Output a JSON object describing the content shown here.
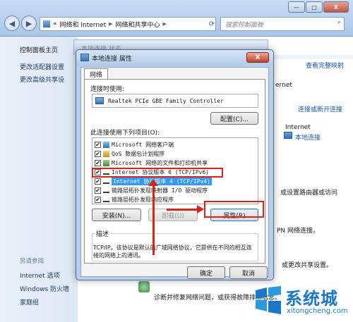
{
  "window": {
    "caption_minimize": "—",
    "caption_maximize": "□",
    "caption_close": "X",
    "back_icon": "◀",
    "forward_icon": "▶",
    "breadcrumb": [
      "«",
      "网络和 Internet",
      "网络和共享中心"
    ],
    "search_placeholder": "搜索控制面板"
  },
  "left_pane": {
    "home": "控制面板主页",
    "items": [
      "更改适配器设置",
      "更改高级共享设"
    ],
    "see_also_header": "另请参阅",
    "see_also": [
      "Internet 选项",
      "Windows 防火墙",
      "家庭组"
    ]
  },
  "background": {
    "ghost_title": "本地连接 状态",
    "view_full_map": "查看完整映射",
    "internet_fragment": "ernet",
    "connect_disconnect": "连接或断开连接",
    "internet_label": "Internet",
    "local_connection": "本地连接",
    "fragment_router": "或设置路由器或访问",
    "fragment_vpn": "PN 网络连接。",
    "fragment_sharing": "或更改共享设置。",
    "diag_text": "诊断并修复网络问题，或获得故障排除信息。"
  },
  "dialog": {
    "title": "本地连接 属性",
    "close_label": "X",
    "tab_network": "网络",
    "connect_using_label": "连接时使用:",
    "adapter_name": "Realtek PCIe GBE Family Controller",
    "configure_button": "配置(C)...",
    "items_label": "此连接使用下列项目(O):",
    "items": [
      {
        "check": "✔",
        "text": "Microsoft 网络客户端"
      },
      {
        "check": "✔",
        "text": "QoS 数据包计划程序"
      },
      {
        "check": "✔",
        "text": "Microsoft 网络的文件和打印机共享"
      },
      {
        "check": "✔",
        "text": "Internet 协议版本 6 (TCP/IPv6)"
      },
      {
        "check": "✔",
        "text": "Internet 协议版本 4 (TCP/IPv4)"
      },
      {
        "check": "✔",
        "text": "链路层拓扑发现映射器 I/O 驱动程序"
      },
      {
        "check": "✔",
        "text": "链路层拓扑发现响应程序"
      }
    ],
    "install_button": "安装(N)...",
    "uninstall_button": "卸载(U)",
    "properties_button": "属性(R)",
    "description_label": "描述",
    "description_text": "TCP/IP。该协议是默认的广域网络协议，它提供在不同的相互连接的网络上的通讯。",
    "ok_button": "确定",
    "cancel_button": "取消"
  },
  "watermark": {
    "cn": "系统城",
    "en": "xitongcheng.com"
  },
  "colors": {
    "annotation_red": "#d5251d",
    "selection_blue": "#3399ff",
    "watermark_blue": "#1b78c8"
  }
}
